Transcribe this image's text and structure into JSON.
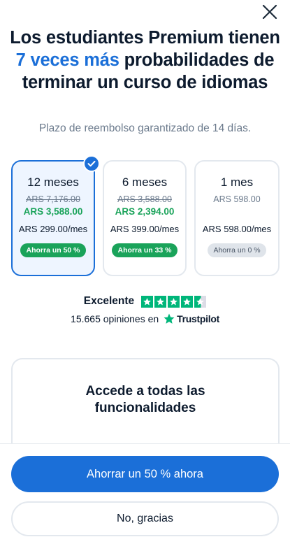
{
  "close": {
    "icon": "close-icon"
  },
  "headline": {
    "part1": "Los estudiantes Premium tienen ",
    "accent": "7 veces más",
    "part2": " probabilidades de terminar un curso de idiomas"
  },
  "subtitle": "Plazo de reembolso garantizado de 14 días.",
  "colors": {
    "accent": "#1b6fd8",
    "success": "#1aa35a",
    "trustpilot": "#00b67a"
  },
  "plans": [
    {
      "duration": "12 meses",
      "old_price": "ARS 7,176.00",
      "new_price": "ARS 3,588.00",
      "monthly": "ARS 299.00/mes",
      "badge": "Ahorra un 50 %",
      "selected": true
    },
    {
      "duration": "6 meses",
      "old_price": "ARS 3,588.00",
      "new_price": "ARS 2,394.00",
      "monthly": "ARS 399.00/mes",
      "badge": "Ahorra un 33 %",
      "selected": false
    },
    {
      "duration": "1 mes",
      "old_price": "ARS 598.00",
      "new_price": "",
      "monthly": "ARS 598.00/mes",
      "badge": "Ahorra un 0 %",
      "selected": false
    }
  ],
  "rating": {
    "label": "Excelente",
    "stars": 4.5,
    "reviews": "15.665 opiniones en",
    "brand": "Trustpilot"
  },
  "features": {
    "title": "Accede a todas las funcionalidades"
  },
  "cta": {
    "primary": "Ahorrar un 50 % ahora",
    "secondary": "No, gracias"
  }
}
